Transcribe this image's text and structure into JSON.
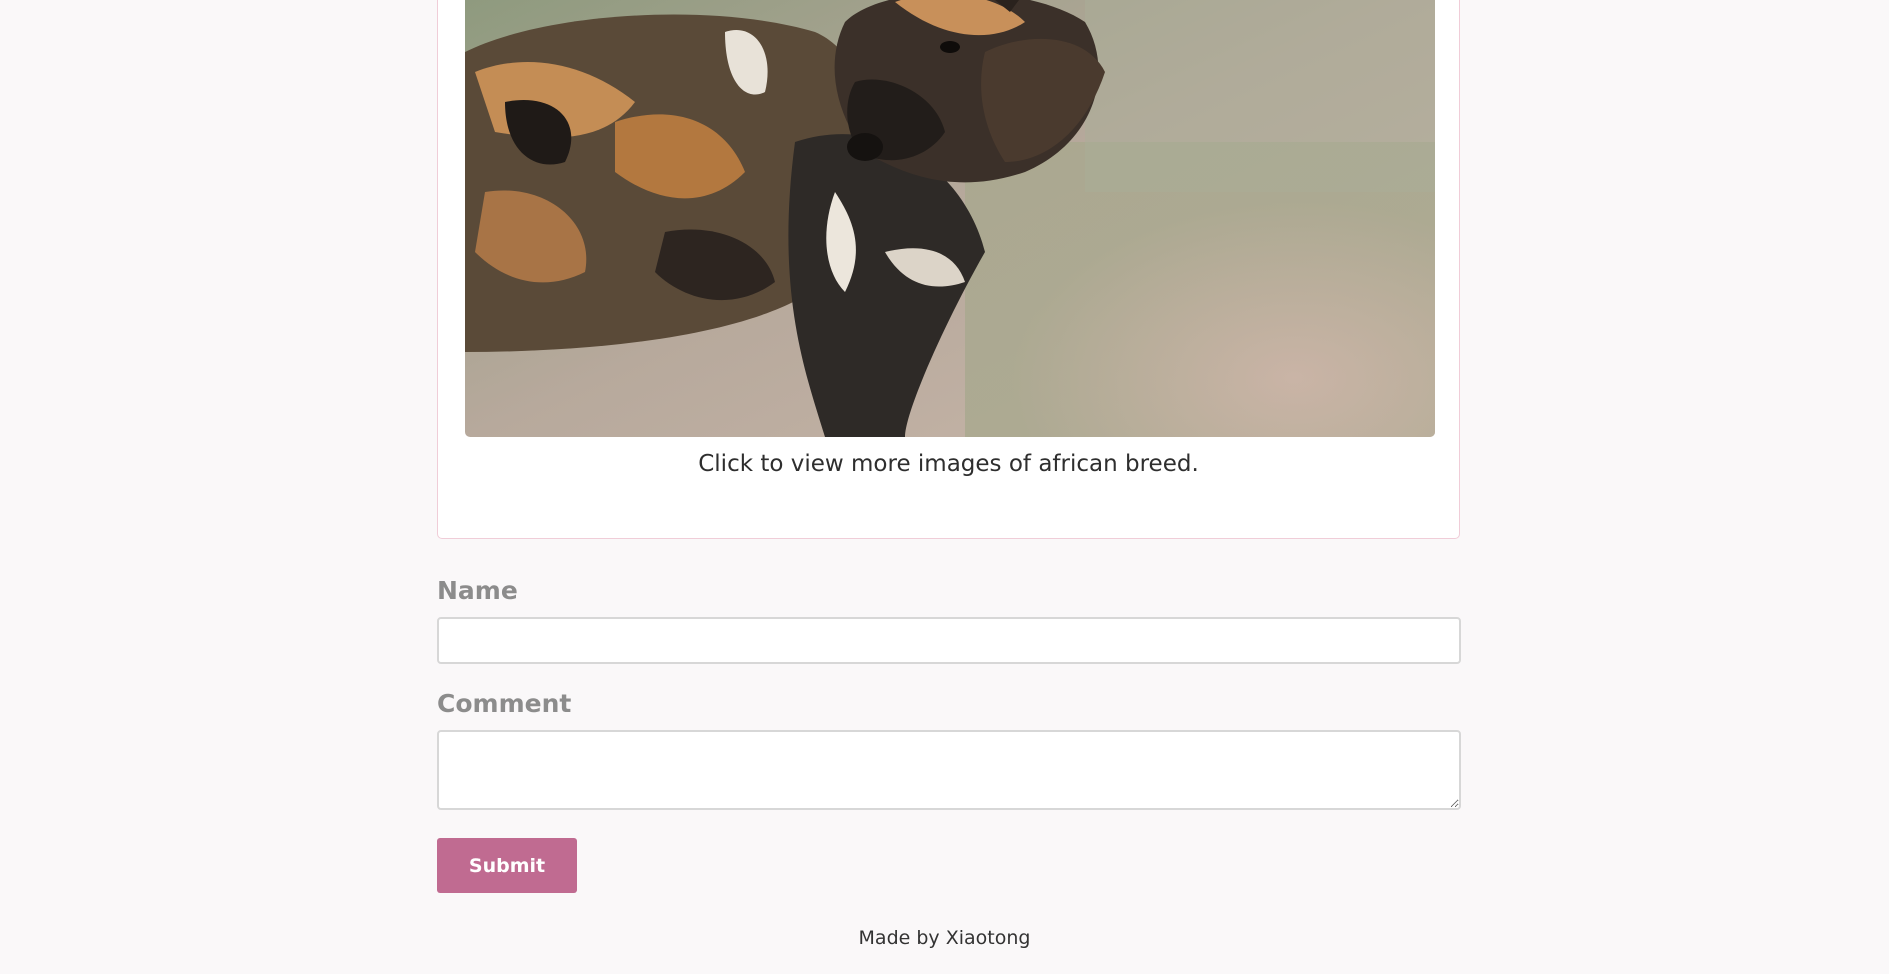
{
  "card": {
    "image_subject": "african wild dog",
    "caption": "Click to view more images of african breed."
  },
  "form": {
    "name_label": "Name",
    "name_value": "",
    "comment_label": "Comment",
    "comment_value": "",
    "submit_label": "Submit"
  },
  "footer": {
    "text": "Made by Xiaotong"
  },
  "colors": {
    "page_background": "#faf8f9",
    "card_border": "#f0cdd8",
    "label_gray": "#8c8c8c",
    "submit_button": "#c06b91"
  }
}
